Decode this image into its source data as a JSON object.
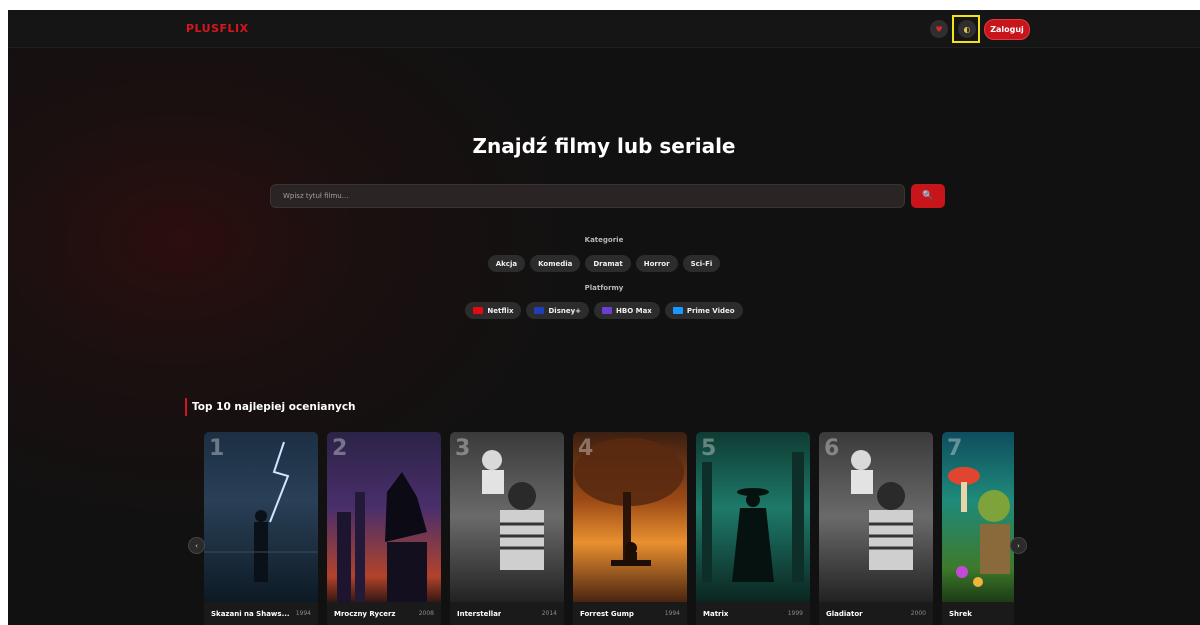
{
  "header": {
    "logo": "PLUSFLIX",
    "login_label": "Zaloguj",
    "favorites_icon": "heart-icon",
    "theme_icon": "theme-toggle-icon"
  },
  "hero": {
    "title": "Znajdź filmy lub seriale",
    "search_placeholder": "Wpisz tytuł filmu...",
    "search_icon": "search-icon"
  },
  "categories": {
    "label": "Kategorie",
    "items": [
      "Akcja",
      "Komedia",
      "Dramat",
      "Horror",
      "Sci-Fi"
    ]
  },
  "platforms": {
    "label": "Platformy",
    "items": [
      {
        "name": "Netflix",
        "color": "#e50914"
      },
      {
        "name": "Disney+",
        "color": "#1f3fb8"
      },
      {
        "name": "HBO Max",
        "color": "#6b3fd1"
      },
      {
        "name": "Prime Video",
        "color": "#1a98ff"
      }
    ]
  },
  "top10": {
    "heading": "Top 10 najlepiej ocenianych",
    "movies": [
      {
        "rank": "1",
        "title": "Skazani na Shaws...",
        "year": "1994"
      },
      {
        "rank": "2",
        "title": "Mroczny Rycerz",
        "year": "2008"
      },
      {
        "rank": "3",
        "title": "Interstellar",
        "year": "2014"
      },
      {
        "rank": "4",
        "title": "Forrest Gump",
        "year": "1994"
      },
      {
        "rank": "5",
        "title": "Matrix",
        "year": "1999"
      },
      {
        "rank": "6",
        "title": "Gladiator",
        "year": "2000"
      },
      {
        "rank": "7",
        "title": "Shrek",
        "year": ""
      }
    ]
  },
  "colors": {
    "accent": "#d5171c",
    "background": "#111111"
  }
}
